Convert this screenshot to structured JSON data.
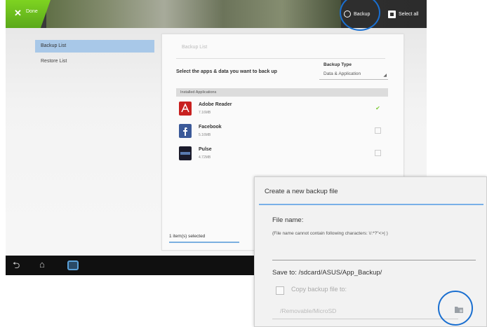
{
  "action_bar": {
    "done_label": "Done",
    "backup_label": "Backup",
    "select_all_label": "Select all"
  },
  "sidebar": {
    "items": [
      {
        "label": "Backup List",
        "active": true
      },
      {
        "label": "Restore List",
        "active": false
      }
    ]
  },
  "panel": {
    "title": "Backup List",
    "prompt": "Select the apps & data you want to back up",
    "backup_type_label": "Backup Type",
    "backup_type_value": "Data & Application",
    "installed_header": "Installed Applications",
    "apps": [
      {
        "name": "Adobe Reader",
        "size": "7.16MB",
        "checked": true
      },
      {
        "name": "Facebook",
        "size": "5.16MB",
        "checked": false
      },
      {
        "name": "Pulse",
        "size": "4.72MB",
        "checked": false
      }
    ],
    "selected_count": "1 item(s) selected"
  },
  "dialog": {
    "title": "Create a new backup file",
    "file_name_label": "File name:",
    "file_name_hint": "(File name cannot contain following characters: \\/:*?\"<>| )",
    "file_name_value": "",
    "save_to": "Save to:  /sdcard/ASUS/App_Backup/",
    "copy_label": "Copy backup file to:",
    "copy_path": "/Removable/MicroSD"
  },
  "colors": {
    "accent_blue": "#1a6fd0",
    "done_green": "#6cbf1e",
    "dialog_accent": "#7ab0e8"
  }
}
